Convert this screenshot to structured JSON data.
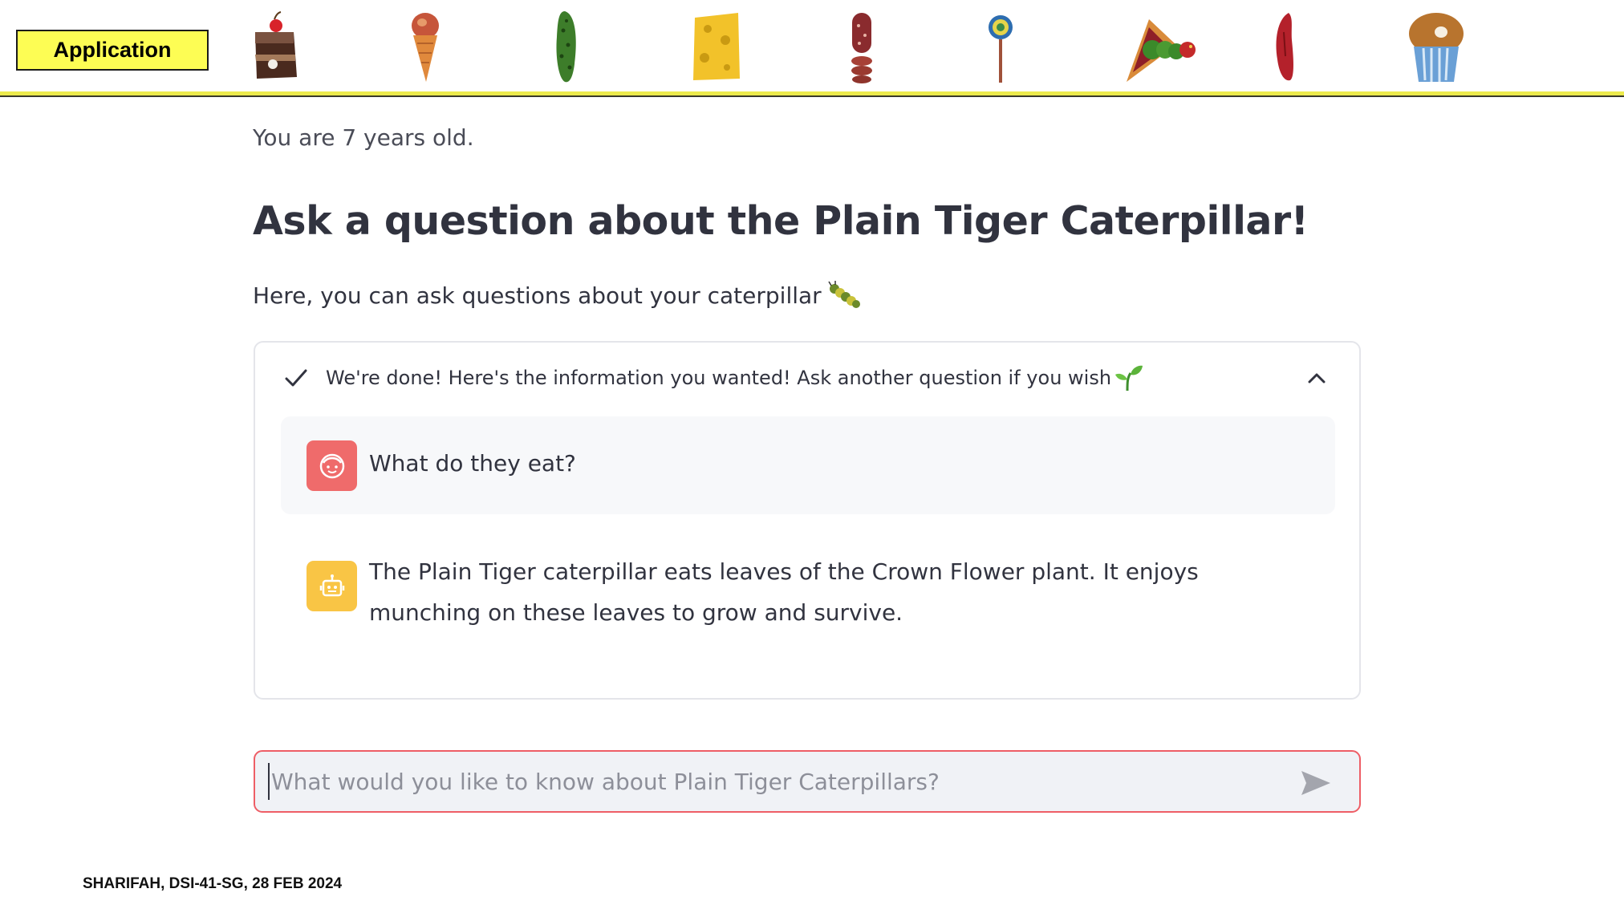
{
  "header": {
    "app_label": "Application",
    "foods": [
      "cake-icon",
      "ice-cream-cone-icon",
      "pickle-icon",
      "swiss-cheese-icon",
      "salami-icon",
      "lollipop-icon",
      "cherry-pie-icon",
      "sausage-icon",
      "cupcake-icon"
    ]
  },
  "main": {
    "age_text": "You are 7 years old.",
    "title": "Ask a question about the Plain Tiger Caterpillar!",
    "subtitle": "Here, you can ask questions about your caterpillar"
  },
  "expander": {
    "status": "We're done! Here's the information you wanted! Ask another question if you wish",
    "messages": [
      {
        "role": "user",
        "text": "What do they eat?"
      },
      {
        "role": "assistant",
        "text": "The Plain Tiger caterpillar eats leaves of the Crown Flower plant. It enjoys munching on these leaves to grow and survive."
      }
    ]
  },
  "chat_input": {
    "placeholder": "What would you like to know about Plain Tiger Caterpillars?",
    "value": ""
  },
  "footer": {
    "text": "SHARIFAH, DSI-41-SG, 28 FEB 2024"
  },
  "colors": {
    "banner_yellow": "#fdfd54",
    "user_avatar": "#ef6b6b",
    "bot_avatar": "#f9c545",
    "input_border": "#ee5e66"
  }
}
